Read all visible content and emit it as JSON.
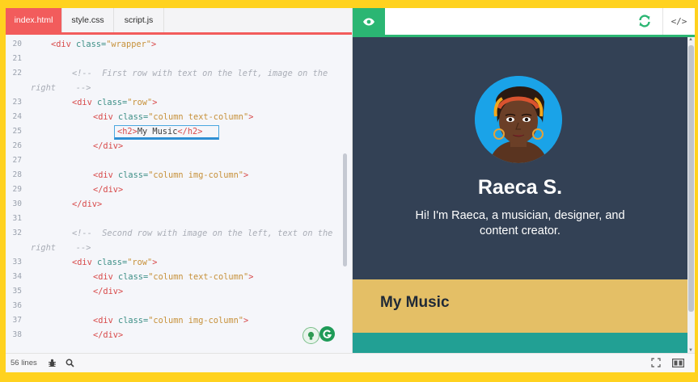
{
  "editor": {
    "tabs": [
      {
        "label": "index.html",
        "active": true
      },
      {
        "label": "style.css",
        "active": false
      },
      {
        "label": "script.js",
        "active": false
      }
    ],
    "lines": [
      {
        "n": "20",
        "indent": 1,
        "parts": [
          [
            "tag",
            "<div "
          ],
          [
            "attr",
            "class="
          ],
          [
            "str",
            "\"wrapper\""
          ],
          [
            "tag",
            ">"
          ]
        ]
      },
      {
        "n": "21",
        "indent": 0,
        "parts": []
      },
      {
        "n": "22",
        "indent": 2,
        "parts": [
          [
            "cmt",
            "<!--  First row with text on the left, image on the"
          ]
        ]
      },
      {
        "n": "",
        "indent": 0,
        "parts": [
          [
            "cmt",
            "right    -->"
          ]
        ]
      },
      {
        "n": "23",
        "indent": 2,
        "parts": [
          [
            "tag",
            "<div "
          ],
          [
            "attr",
            "class="
          ],
          [
            "str",
            "\"row\""
          ],
          [
            "tag",
            ">"
          ]
        ]
      },
      {
        "n": "24",
        "indent": 3,
        "parts": [
          [
            "tag",
            "<div "
          ],
          [
            "attr",
            "class="
          ],
          [
            "str",
            "\"column text-column\""
          ],
          [
            "tag",
            ">"
          ]
        ]
      },
      {
        "n": "25",
        "indent": 4,
        "parts": [
          [
            "tag",
            "<h2>"
          ],
          [
            "txt",
            "My Music"
          ],
          [
            "tag",
            "</h2>"
          ]
        ],
        "boxed": true
      },
      {
        "n": "26",
        "indent": 3,
        "parts": [
          [
            "tag",
            "</div>"
          ]
        ]
      },
      {
        "n": "27",
        "indent": 0,
        "parts": []
      },
      {
        "n": "28",
        "indent": 3,
        "parts": [
          [
            "tag",
            "<div "
          ],
          [
            "attr",
            "class="
          ],
          [
            "str",
            "\"column img-column\""
          ],
          [
            "tag",
            ">"
          ]
        ]
      },
      {
        "n": "29",
        "indent": 3,
        "parts": [
          [
            "tag",
            "</div>"
          ]
        ]
      },
      {
        "n": "30",
        "indent": 2,
        "parts": [
          [
            "tag",
            "</div>"
          ]
        ]
      },
      {
        "n": "31",
        "indent": 0,
        "parts": []
      },
      {
        "n": "32",
        "indent": 2,
        "parts": [
          [
            "cmt",
            "<!--  Second row with image on the left, text on the"
          ]
        ]
      },
      {
        "n": "",
        "indent": 0,
        "parts": [
          [
            "cmt",
            "right    -->"
          ]
        ]
      },
      {
        "n": "33",
        "indent": 2,
        "parts": [
          [
            "tag",
            "<div "
          ],
          [
            "attr",
            "class="
          ],
          [
            "str",
            "\"row\""
          ],
          [
            "tag",
            ">"
          ]
        ]
      },
      {
        "n": "34",
        "indent": 3,
        "parts": [
          [
            "tag",
            "<div "
          ],
          [
            "attr",
            "class="
          ],
          [
            "str",
            "\"column text-column\""
          ],
          [
            "tag",
            ">"
          ]
        ]
      },
      {
        "n": "35",
        "indent": 3,
        "parts": [
          [
            "tag",
            "</div>"
          ]
        ]
      },
      {
        "n": "36",
        "indent": 0,
        "parts": []
      },
      {
        "n": "37",
        "indent": 3,
        "parts": [
          [
            "tag",
            "<div "
          ],
          [
            "attr",
            "class="
          ],
          [
            "str",
            "\"column img-column\""
          ],
          [
            "tag",
            ">"
          ]
        ]
      },
      {
        "n": "38",
        "indent": 3,
        "parts": [
          [
            "tag",
            "</div>"
          ]
        ]
      }
    ]
  },
  "preview": {
    "icons": {
      "view": "eye-icon",
      "refresh": "refresh-icon",
      "code": "code-icon"
    },
    "code_toggle_label": "</>",
    "name": "Raeca S.",
    "bio": "Hi! I'm Raeca, a musician, designer, and content creator.",
    "section_title": "My Music",
    "colors": {
      "hero": "#334155",
      "section": "#e4bf66",
      "accent": "#22a094",
      "tab": "#f25c5c",
      "preview_tab": "#2bb673"
    }
  },
  "status": {
    "lines_label": "56 lines",
    "icons": [
      "bug-icon",
      "search-icon",
      "fullscreen-icon",
      "layout-icon"
    ]
  }
}
